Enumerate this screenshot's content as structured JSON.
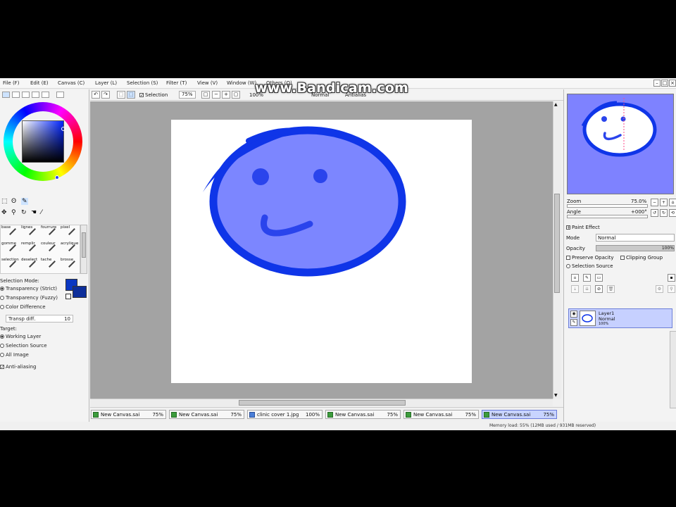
{
  "watermark": "www.Bandicam.com",
  "menu": [
    "File (F)",
    "Edit (E)",
    "Canvas (C)",
    "Layer (L)",
    "Selection (S)",
    "Filter (T)",
    "View (V)",
    "Window (W)",
    "Others (O)"
  ],
  "canvas_toolbar": {
    "selection_label": "Selection",
    "zoom": "75%",
    "zoom2": "100%",
    "mode": "Normal",
    "antialias": "Antialias"
  },
  "colors": {
    "fg": "#0a37c2",
    "bg": "#0d2e9a",
    "canvas_bg": "#a3a3a3",
    "navigator_bg": "#7e82ff",
    "face_fill": "#7c86ff",
    "face_stroke": "#0f35e8"
  },
  "brushes": [
    {
      "label": "base",
      "icon": "pencil-icon"
    },
    {
      "label": "lignes",
      "icon": "pencil-icon"
    },
    {
      "label": "fourrure",
      "icon": "pencil-icon"
    },
    {
      "label": "pixel",
      "icon": "pencil-icon"
    },
    {
      "label": "gomme",
      "icon": "eraser-icon"
    },
    {
      "label": "remplir",
      "icon": "bucket-icon"
    },
    {
      "label": "couleur",
      "icon": "brush-icon"
    },
    {
      "label": "acrylique",
      "icon": "brush-icon"
    },
    {
      "label": "selection",
      "icon": "brush-icon"
    },
    {
      "label": "deselect",
      "icon": "brush-icon"
    },
    {
      "label": "tache",
      "icon": "brush-icon"
    },
    {
      "label": "brosse",
      "icon": "brush-icon"
    }
  ],
  "tool_options": {
    "selection_mode_title": "Selection Mode:",
    "modes": [
      "Transparency (Strict)",
      "Transparency (Fuzzy)",
      "Color Difference"
    ],
    "selected_mode": 0,
    "transp_diff_label": "Transp diff.",
    "transp_diff_value": "10",
    "target_title": "Target:",
    "targets": [
      "Working Layer",
      "Selection Source",
      "All Image"
    ],
    "selected_target": 0,
    "antialiasing_label": "Anti-aliasing"
  },
  "tabs": [
    {
      "name": "New Canvas.sai",
      "zoom": "75%",
      "active": false
    },
    {
      "name": "New Canvas.sai",
      "zoom": "75%",
      "active": false
    },
    {
      "name": "clinic cover 1.jpg",
      "zoom": "100%",
      "active": false
    },
    {
      "name": "New Canvas.sai",
      "zoom": "75%",
      "active": false
    },
    {
      "name": "New Canvas.sai",
      "zoom": "75%",
      "active": false
    },
    {
      "name": "New Canvas.sai",
      "zoom": "75%",
      "active": true
    }
  ],
  "status": "Memory load: 55% (12MB used / 931MB reserved)",
  "right_panel": {
    "zoom_label": "Zoom",
    "zoom_value": "75.0%",
    "angle_label": "Angle",
    "angle_value": "+000°",
    "paint_effect_label": "Paint Effect",
    "mode_label": "Mode",
    "mode_value": "Normal",
    "opacity_label": "Opacity",
    "opacity_value": "100%",
    "preserve_opacity": "Preserve Opacity",
    "clipping_group": "Clipping Group",
    "selection_source": "Selection Source",
    "layer": {
      "name": "Layer1",
      "mode": "Normal",
      "opacity": "100%"
    }
  }
}
